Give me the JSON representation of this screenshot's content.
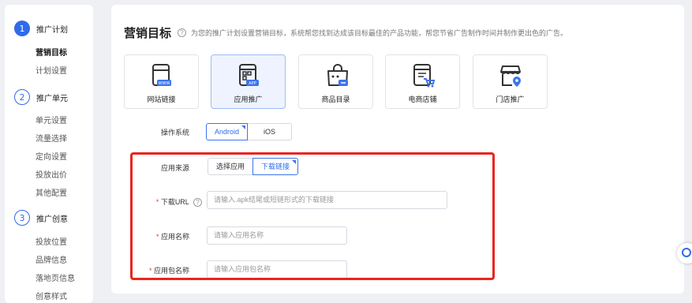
{
  "sidebar": {
    "steps": [
      {
        "num": "1",
        "label": "推广计划",
        "items": [
          "营销目标",
          "计划设置"
        ]
      },
      {
        "num": "2",
        "label": "推广单元",
        "items": [
          "单元设置",
          "流量选择",
          "定向设置",
          "投放出价",
          "其他配置"
        ]
      },
      {
        "num": "3",
        "label": "推广创意",
        "items": [
          "投放位置",
          "品牌信息",
          "落地页信息",
          "创意样式"
        ]
      }
    ]
  },
  "main": {
    "title": "营销目标",
    "help_glyph": "?",
    "description": "为您的推广计划设置营销目标，系统帮您找到达成该目标最佳的产品功能，帮您节省广告制作时间并制作更出色的广告。",
    "goals": [
      {
        "label": "网站链接",
        "icon": "website-icon",
        "selected": false
      },
      {
        "label": "应用推广",
        "icon": "app-icon",
        "selected": true
      },
      {
        "label": "商品目录",
        "icon": "product-catalog-icon",
        "selected": false
      },
      {
        "label": "电商店铺",
        "icon": "ecommerce-store-icon",
        "selected": false
      },
      {
        "label": "门店推广",
        "icon": "store-location-icon",
        "selected": false
      }
    ],
    "os": {
      "label": "操作系统",
      "options": [
        "Android",
        "iOS"
      ],
      "selected": "Android"
    },
    "source": {
      "label": "应用来源",
      "options": [
        "选择应用",
        "下载链接"
      ],
      "selected": "下载链接"
    },
    "download_url": {
      "required": "*",
      "label": "下载URL",
      "placeholder": "请输入.apk结尾或短链形式的下载链接"
    },
    "app_name": {
      "required": "*",
      "label": "应用名称",
      "placeholder": "请输入应用名称"
    },
    "package_name": {
      "required": "*",
      "label": "应用包名称",
      "placeholder": "请输入应用包名称"
    }
  },
  "colors": {
    "accent": "#2f6bea",
    "highlight": "#e8251f",
    "required": "#e23a2a"
  }
}
